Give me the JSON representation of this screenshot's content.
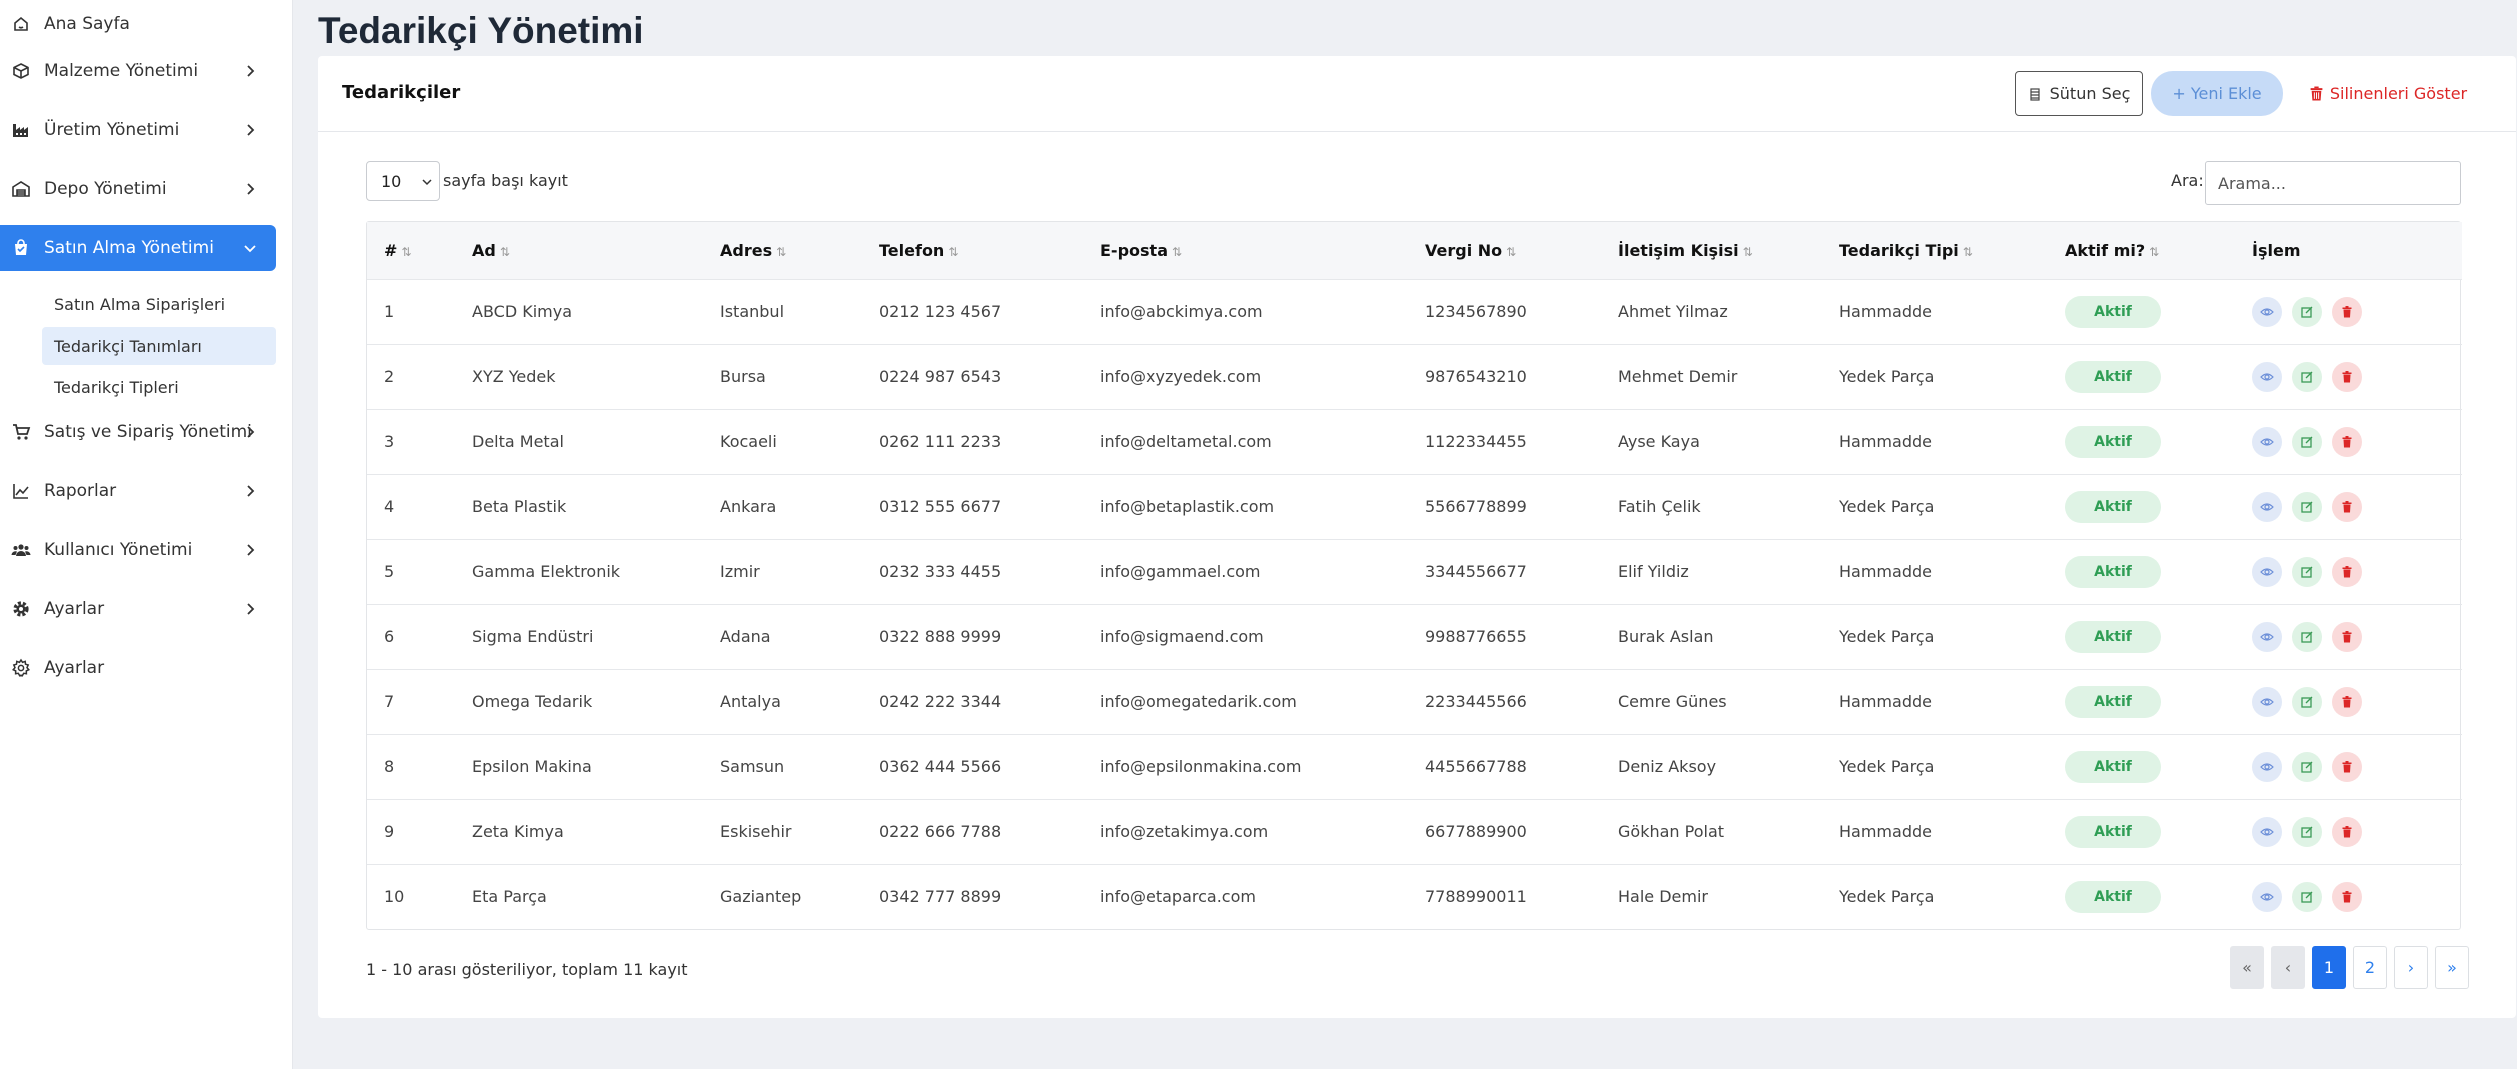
{
  "sidebar": {
    "items": [
      {
        "label": "Ana Sayfa",
        "icon": "home-icon"
      },
      {
        "label": "Malzeme Yönetimi",
        "icon": "box-icon"
      },
      {
        "label": "Üretim Yönetimi",
        "icon": "factory-icon"
      },
      {
        "label": "Depo Yönetimi",
        "icon": "warehouse-icon"
      },
      {
        "label": "Satın Alma Yönetimi",
        "icon": "shopping-bag-icon"
      },
      {
        "label": "Satış ve Sipariş Yönetimi",
        "icon": "cart-icon"
      },
      {
        "label": "Raporlar",
        "icon": "chart-line-icon"
      },
      {
        "label": "Kullanıcı Yönetimi",
        "icon": "users-icon"
      },
      {
        "label": "Ayarlar",
        "icon": "gear-icon"
      },
      {
        "label": "Ayarlar",
        "icon": "gear-outline-icon"
      }
    ],
    "subitems": [
      {
        "label": "Satın Alma Siparişleri"
      },
      {
        "label": "Tedarikçi Tanımları"
      },
      {
        "label": "Tedarikçi Tipleri"
      }
    ]
  },
  "page": {
    "title": "Tedarikçi Yönetimi"
  },
  "card": {
    "title": "Tedarikçiler",
    "columns_button": "Sütun Seç",
    "new_button": "+ Yeni Ekle",
    "deleted_button": "Silinenleri Göster",
    "page_length": "10",
    "page_length_label": "sayfa başı kayıt",
    "search_label": "Ara:",
    "search_placeholder": "Arama..."
  },
  "table": {
    "headers": [
      "#",
      "Ad",
      "Adres",
      "Telefon",
      "E-posta",
      "Vergi No",
      "İletişim Kişisi",
      "Tedarikçi Tipi",
      "Aktif mi?",
      "İşlem"
    ],
    "rows": [
      [
        "1",
        "ABCD Kimya",
        "Istanbul",
        "0212 123 4567",
        "info@abckimya.com",
        "1234567890",
        "Ahmet Yilmaz",
        "Hammadde",
        "Aktif"
      ],
      [
        "2",
        "XYZ Yedek",
        "Bursa",
        "0224 987 6543",
        "info@xyzyedek.com",
        "9876543210",
        "Mehmet Demir",
        "Yedek Parça",
        "Aktif"
      ],
      [
        "3",
        "Delta Metal",
        "Kocaeli",
        "0262 111 2233",
        "info@deltametal.com",
        "1122334455",
        "Ayse Kaya",
        "Hammadde",
        "Aktif"
      ],
      [
        "4",
        "Beta Plastik",
        "Ankara",
        "0312 555 6677",
        "info@betaplastik.com",
        "5566778899",
        "Fatih Çelik",
        "Yedek Parça",
        "Aktif"
      ],
      [
        "5",
        "Gamma Elektronik",
        "Izmir",
        "0232 333 4455",
        "info@gammael.com",
        "3344556677",
        "Elif Yildiz",
        "Hammadde",
        "Aktif"
      ],
      [
        "6",
        "Sigma Endüstri",
        "Adana",
        "0322 888 9999",
        "info@sigmaend.com",
        "9988776655",
        "Burak Aslan",
        "Yedek Parça",
        "Aktif"
      ],
      [
        "7",
        "Omega Tedarik",
        "Antalya",
        "0242 222 3344",
        "info@omegatedarik.com",
        "2233445566",
        "Cemre Günes",
        "Hammadde",
        "Aktif"
      ],
      [
        "8",
        "Epsilon Makina",
        "Samsun",
        "0362 444 5566",
        "info@epsilonmakina.com",
        "4455667788",
        "Deniz Aksoy",
        "Yedek Parça",
        "Aktif"
      ],
      [
        "9",
        "Zeta Kimya",
        "Eskisehir",
        "0222 666 7788",
        "info@zetakimya.com",
        "6677889900",
        "Gökhan Polat",
        "Hammadde",
        "Aktif"
      ],
      [
        "10",
        "Eta Parça",
        "Gaziantep",
        "0342 777 8899",
        "info@etaparca.com",
        "7788990011",
        "Hale Demir",
        "Yedek Parça",
        "Aktif"
      ]
    ]
  },
  "footer": {
    "info": "1 - 10 arası gösteriliyor, toplam 11 kayıt",
    "pager": [
      "«",
      "‹",
      "1",
      "2",
      "›",
      "»"
    ]
  },
  "colors": {
    "accent": "#2f80ed",
    "danger": "#dc2626",
    "success": "#2f9e55"
  }
}
